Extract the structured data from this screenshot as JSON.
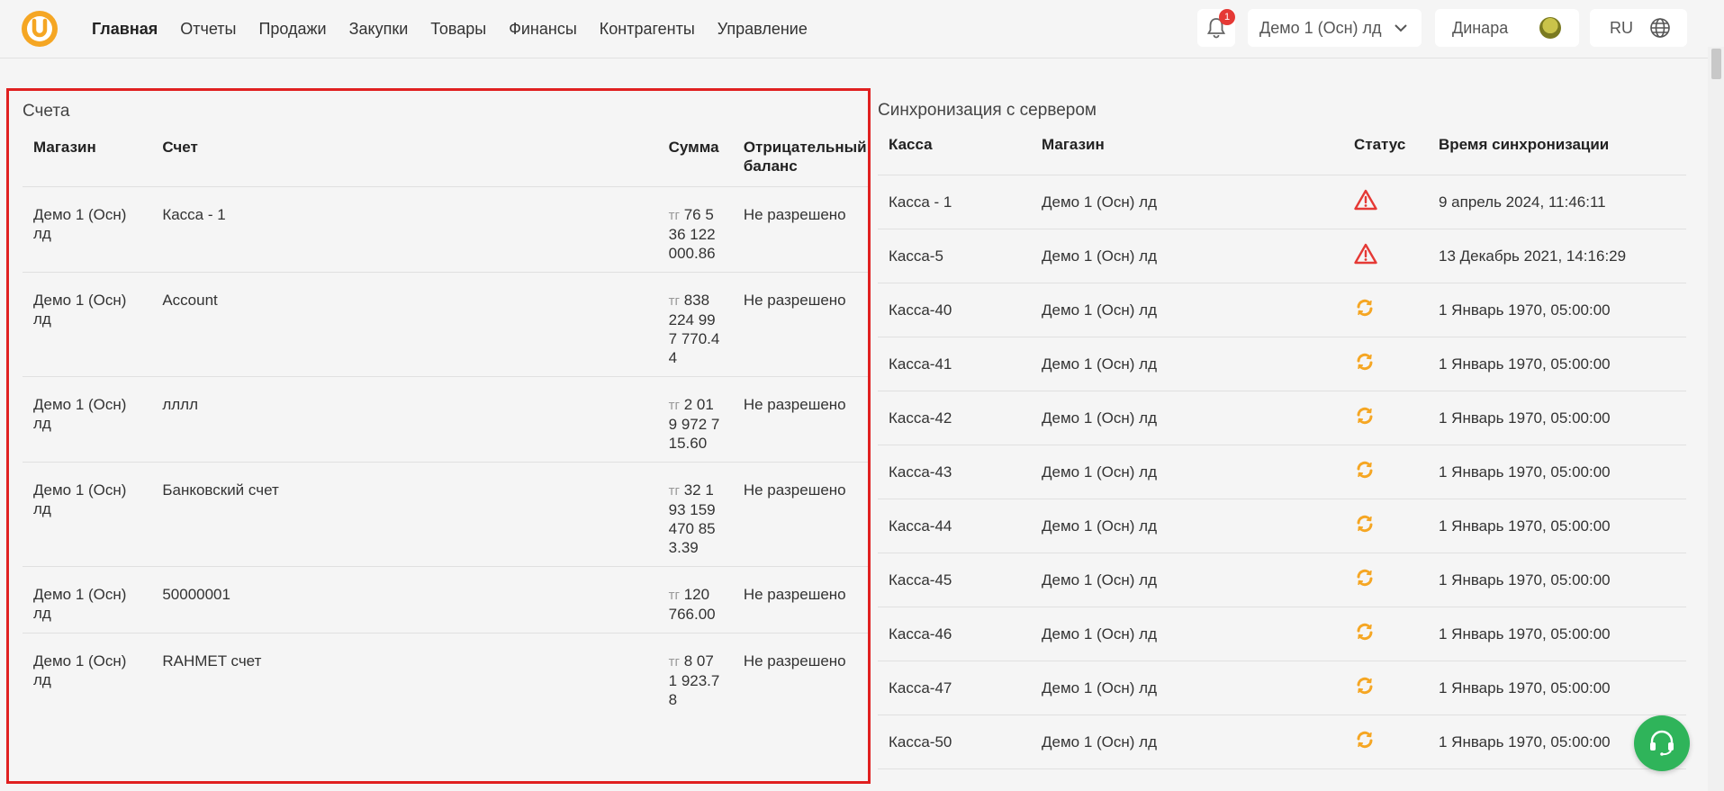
{
  "nav": {
    "items": [
      {
        "label": "Главная",
        "active": true
      },
      {
        "label": "Отчеты"
      },
      {
        "label": "Продажи"
      },
      {
        "label": "Закупки"
      },
      {
        "label": "Товары"
      },
      {
        "label": "Финансы"
      },
      {
        "label": "Контрагенты"
      },
      {
        "label": "Управление"
      }
    ]
  },
  "header": {
    "notification_count": "1",
    "store_selected": "Демо 1 (Осн) лд",
    "user_name": "Динара",
    "language": "RU",
    "logo_letter": "U",
    "accent_color": "#f5a623"
  },
  "accounts": {
    "title": "Счета",
    "columns": [
      "Магазин",
      "Счет",
      "Сумма",
      "Отрицательный баланс"
    ],
    "rows": [
      {
        "shop": "Демо 1 (Осн) лд",
        "account": "Касса - 1",
        "currency": "тг",
        "amount": "76 536 122 000.86",
        "negative": "Не разрешено"
      },
      {
        "shop": "Демо 1 (Осн) лд",
        "account": "Account",
        "currency": "тг",
        "amount": "838 224 997 770.44",
        "negative": "Не разрешено"
      },
      {
        "shop": "Демо 1 (Осн) лд",
        "account": "лллл",
        "currency": "тг",
        "amount": "2 019 972 715.60",
        "negative": "Не разрешено"
      },
      {
        "shop": "Демо 1 (Осн) лд",
        "account": "Банковский счет",
        "currency": "тг",
        "amount": "32 193 159 470 853.39",
        "negative": "Не разрешено"
      },
      {
        "shop": "Демо 1 (Осн) лд",
        "account": "50000001",
        "currency": "тг",
        "amount": "120 766.00",
        "negative": "Не разрешено"
      },
      {
        "shop": "Демо 1 (Осн) лд",
        "account": "RAHMET счет",
        "currency": "тг",
        "amount": "8 071 923.78",
        "negative": "Не разрешено"
      }
    ]
  },
  "sync": {
    "title": "Синхронизация с сервером",
    "columns": [
      "Касса",
      "Магазин",
      "Статус",
      "Время синхронизации"
    ],
    "rows": [
      {
        "kassa": "Касса - 1",
        "shop": "Демо 1 (Осн) лд",
        "status": "warning-icon",
        "time": "9 апрель 2024, 11:46:11"
      },
      {
        "kassa": "Касса-5",
        "shop": "Демо 1 (Осн) лд",
        "status": "warning-icon",
        "time": "13 Декабрь 2021, 14:16:29"
      },
      {
        "kassa": "Касса-40",
        "shop": "Демо 1 (Осн) лд",
        "status": "sync-icon",
        "time": "1 Январь 1970, 05:00:00"
      },
      {
        "kassa": "Касса-41",
        "shop": "Демо 1 (Осн) лд",
        "status": "sync-icon",
        "time": "1 Январь 1970, 05:00:00"
      },
      {
        "kassa": "Касса-42",
        "shop": "Демо 1 (Осн) лд",
        "status": "sync-icon",
        "time": "1 Январь 1970, 05:00:00"
      },
      {
        "kassa": "Касса-43",
        "shop": "Демо 1 (Осн) лд",
        "status": "sync-icon",
        "time": "1 Январь 1970, 05:00:00"
      },
      {
        "kassa": "Касса-44",
        "shop": "Демо 1 (Осн) лд",
        "status": "sync-icon",
        "time": "1 Январь 1970, 05:00:00"
      },
      {
        "kassa": "Касса-45",
        "shop": "Демо 1 (Осн) лд",
        "status": "sync-icon",
        "time": "1 Январь 1970, 05:00:00"
      },
      {
        "kassa": "Касса-46",
        "shop": "Демо 1 (Осн) лд",
        "status": "sync-icon",
        "time": "1 Январь 1970, 05:00:00"
      },
      {
        "kassa": "Касса-47",
        "shop": "Демо 1 (Осн) лд",
        "status": "sync-icon",
        "time": "1 Январь 1970, 05:00:00"
      },
      {
        "kassa": "Касса-50",
        "shop": "Демо 1 (Осн) лд",
        "status": "sync-icon",
        "time": "1 Январь 1970, 05:00:00"
      }
    ],
    "status_colors": {
      "warning": "#e53935",
      "sync": "#f5a623"
    }
  },
  "support": {
    "icon": "headset-icon",
    "color": "#2fb45a"
  }
}
